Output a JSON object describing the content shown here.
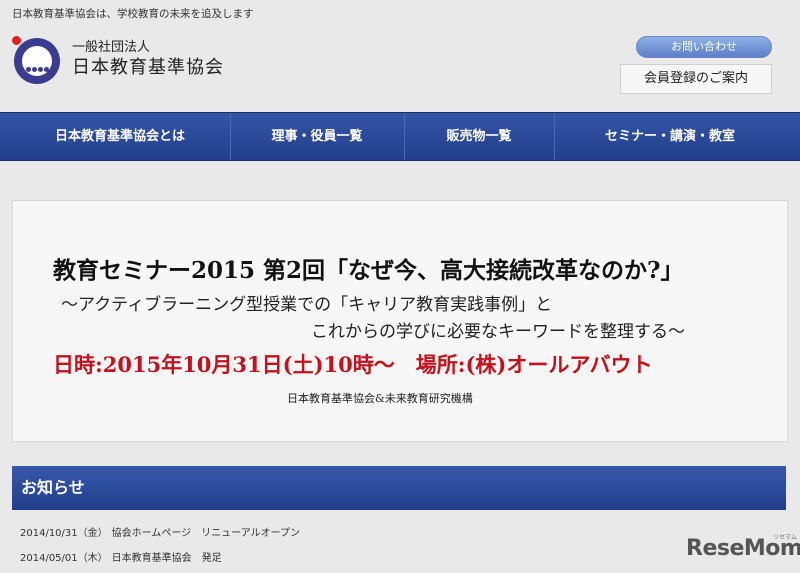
{
  "header": {
    "tagline": "日本教育基準協会は、学校教育の未来を追及します",
    "org_subtitle": "一般社団法人",
    "org_name": "日本教育基準協会",
    "contact_label": "お問い合わせ",
    "member_label": "会員登録のご案内"
  },
  "nav": {
    "items": [
      {
        "label": "日本教育基準協会とは"
      },
      {
        "label": "理事・役員一覧"
      },
      {
        "label": "販売物一覧"
      },
      {
        "label": "セミナー・講演・教室"
      }
    ]
  },
  "banner": {
    "title": "教育セミナー2015 第2回「なぜ今、高大接続改革なのか?」",
    "subtitle_line1": "〜アクティブラーニング型授業での「キャリア教育実践事例」と",
    "subtitle_line2": "これからの学びに必要なキーワードを整理する〜",
    "date_place": "日時:2015年10月31日(土)10時〜　場所:(株)オールアバウト",
    "organizers": "日本教育基準協会&未来教育研究機構",
    "accent_color": "#c4111b"
  },
  "news": {
    "title": "お知らせ",
    "items": [
      {
        "date": "2014/10/31（金）",
        "text": "協会ホームページ　リニューアルオープン"
      },
      {
        "date": "2014/05/01（木）",
        "text": "日本教育基準協会　発足"
      }
    ]
  },
  "watermark": {
    "text": "ReseMom",
    "small": "リセマム"
  },
  "colors": {
    "nav_blue": "#2a4795",
    "page_bg": "#e9e9e9"
  }
}
